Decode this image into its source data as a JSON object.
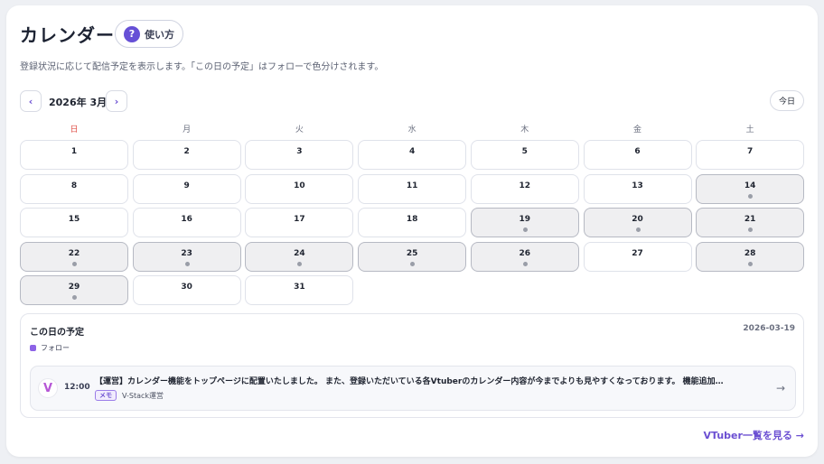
{
  "page": {
    "title": "カレンダー",
    "help_label": "使い方",
    "help_icon": "?",
    "description": "登録状況に応じて配信予定を表示します。「この日の予定」はフォローで色分けされます。"
  },
  "calendar": {
    "prev_label": "‹",
    "next_label": "›",
    "month_label": "2026年 3月",
    "today_label": "今日",
    "weekdays": [
      "日",
      "月",
      "火",
      "水",
      "木",
      "金",
      "土"
    ],
    "days": [
      {
        "num": "1",
        "has_event": false
      },
      {
        "num": "2",
        "has_event": false
      },
      {
        "num": "3",
        "has_event": false
      },
      {
        "num": "4",
        "has_event": false
      },
      {
        "num": "5",
        "has_event": false
      },
      {
        "num": "6",
        "has_event": false
      },
      {
        "num": "7",
        "has_event": false
      },
      {
        "num": "8",
        "has_event": false
      },
      {
        "num": "9",
        "has_event": false
      },
      {
        "num": "10",
        "has_event": false
      },
      {
        "num": "11",
        "has_event": false
      },
      {
        "num": "12",
        "has_event": false
      },
      {
        "num": "13",
        "has_event": false
      },
      {
        "num": "14",
        "has_event": true
      },
      {
        "num": "15",
        "has_event": false
      },
      {
        "num": "16",
        "has_event": false
      },
      {
        "num": "17",
        "has_event": false
      },
      {
        "num": "18",
        "has_event": false
      },
      {
        "num": "19",
        "has_event": true
      },
      {
        "num": "20",
        "has_event": true
      },
      {
        "num": "21",
        "has_event": true
      },
      {
        "num": "22",
        "has_event": true
      },
      {
        "num": "23",
        "has_event": true
      },
      {
        "num": "24",
        "has_event": true
      },
      {
        "num": "25",
        "has_event": true
      },
      {
        "num": "26",
        "has_event": true
      },
      {
        "num": "27",
        "has_event": false
      },
      {
        "num": "28",
        "has_event": true
      },
      {
        "num": "29",
        "has_event": true
      },
      {
        "num": "30",
        "has_event": false
      },
      {
        "num": "31",
        "has_event": false
      }
    ]
  },
  "schedule": {
    "title": "この日の予定",
    "date": "2026-03-19",
    "legend_label": "フォロー",
    "events": [
      {
        "logo": "V",
        "time": "12:00",
        "text": "【運営】カレンダー機能をトップページに配置いたしました。 また、登録いただいている各Vtuberのカレンダー内容が今までよりも見やすくなっております。 機能追加…",
        "tag": "メモ",
        "author": "V-Stack運営",
        "arrow": "→"
      }
    ]
  },
  "footer": {
    "more_link": "VTuber一覧を見る →"
  },
  "colors": {
    "accent": "#6b4fd2",
    "sunday": "#e0524a",
    "event_day_bg": "#efeff1",
    "follow_legend": "#8d63e6"
  }
}
